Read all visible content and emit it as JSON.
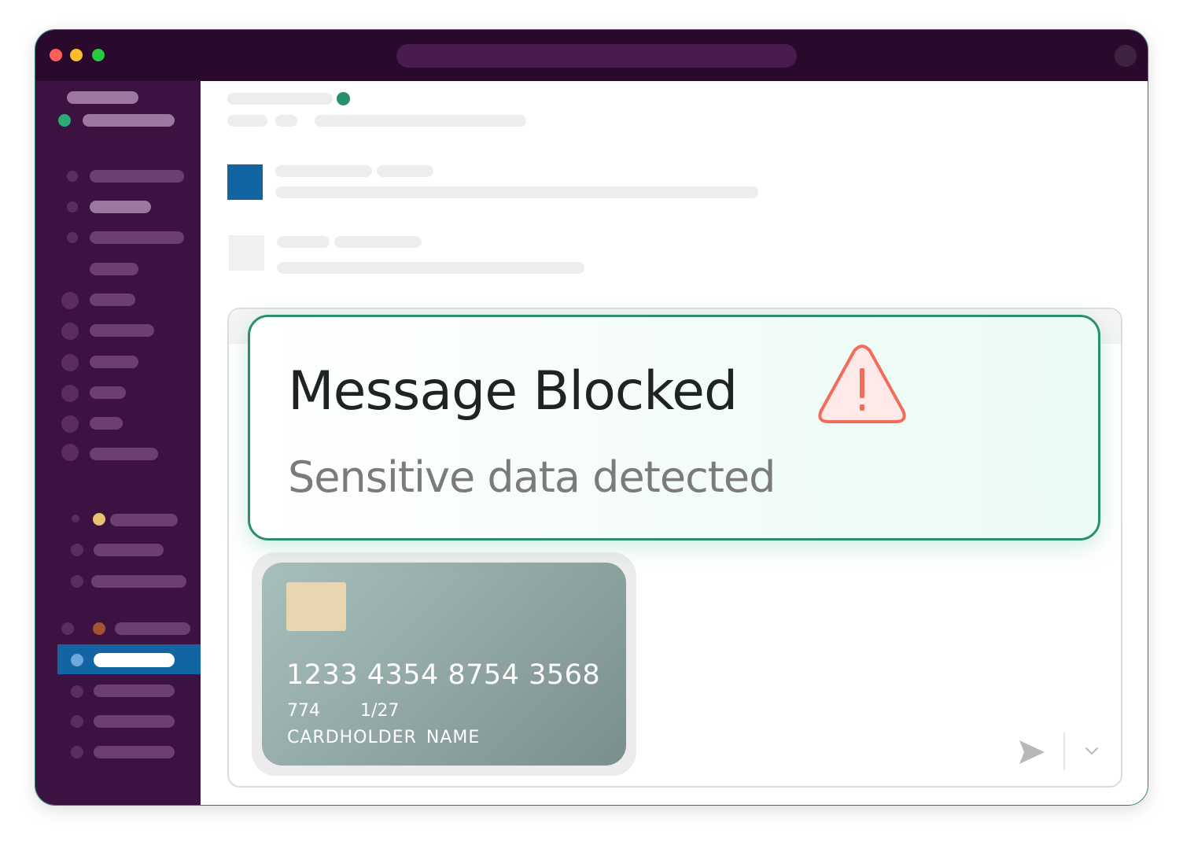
{
  "alert": {
    "title": "Message Blocked",
    "subtitle": "Sensitive data detected",
    "icon": "warning-triangle-icon",
    "icon_color": "#f26b5b"
  },
  "card": {
    "number": "1233 4354 8754 3568",
    "cvv": "774",
    "expiry": "1/27",
    "holder": "CARDHOLDER  NAME"
  },
  "colors": {
    "titlebar": "#2a0a2c",
    "sidebar": "#3c1240",
    "active_item": "#1264a3",
    "online": "#2bac76",
    "alert_border": "#2a8f6c"
  }
}
